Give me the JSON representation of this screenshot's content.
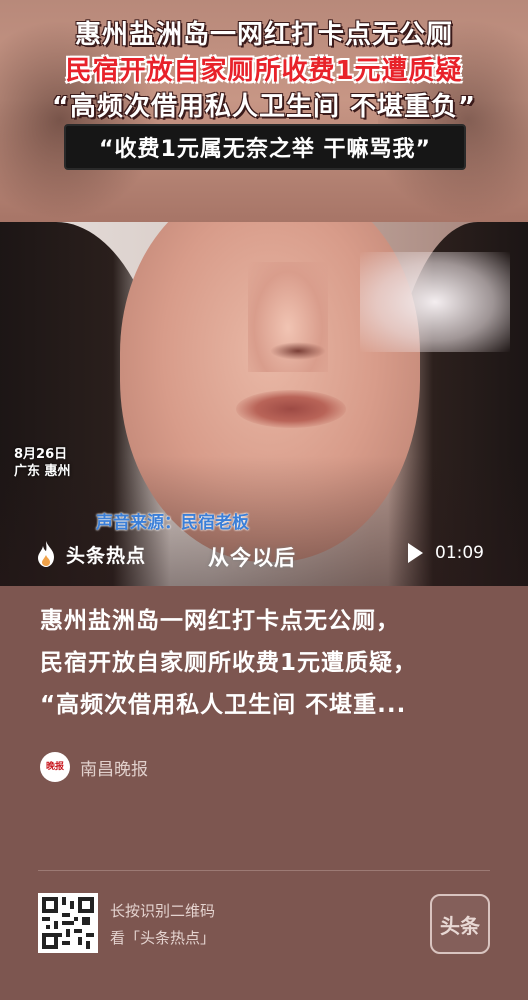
{
  "banner": {
    "headline_1": "惠州盐洲岛一网红打卡点无公厕",
    "headline_2": "民宿开放自家厕所收费1元遭质疑",
    "headline_3": "“高频次借用私人卫生间 不堪重负”",
    "quote": "“收费1元属无奈之举 干嘛骂我”"
  },
  "video": {
    "date": "8月26日",
    "location": "广东 惠州",
    "source_label": "声音来源：民宿老板",
    "subtitle": "从今以后",
    "brand_name": "头条热点",
    "duration": "01:09",
    "icons": {
      "brand": "flame-icon",
      "play": "play-icon"
    }
  },
  "article": {
    "title_line_1": "惠州盐洲岛一网红打卡点无公厕，",
    "title_line_2": "民宿开放自家厕所收费1元遭质疑，",
    "title_line_3": "“高频次借用私人卫生间 不堪重...",
    "publisher": "南昌晚报",
    "publisher_logo_text": "晚报"
  },
  "footer": {
    "qr_hint_1": "长按识别二维码",
    "qr_hint_2": "看「头条热点」",
    "badge": "头条"
  },
  "colors": {
    "background": "#7d5650",
    "headline_red": "#e8222a",
    "source_blue": "#3b7fd8"
  }
}
